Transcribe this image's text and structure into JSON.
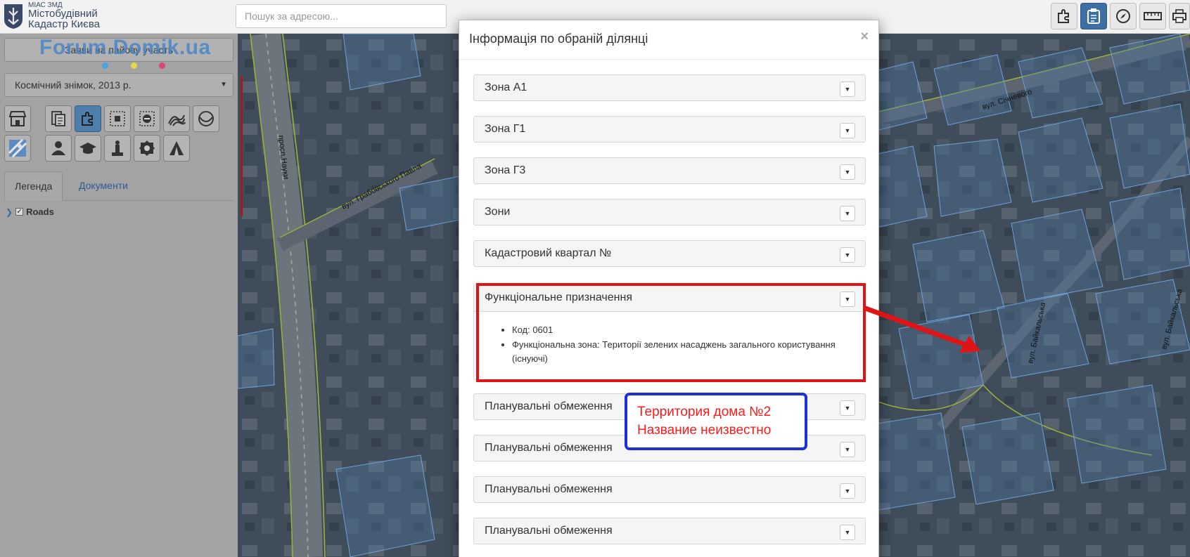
{
  "header": {
    "logo_small": "МІАС ЗМД",
    "logo_line1": "Містобудівний",
    "logo_line2": "Кадастр Києва",
    "search_placeholder": "Пошук за адресою..."
  },
  "sidebar": {
    "apply_button": "Заяви на пайову участь",
    "watermark": "Forum.Domik.ua",
    "layer_select": "Космічний знімок, 2013 р.",
    "tabs": [
      {
        "label": "Легенда",
        "active": true
      },
      {
        "label": "Документи",
        "active": false
      }
    ],
    "legend_item": "Roads"
  },
  "map": {
    "labels": [
      "просп.Науки",
      "вул. Грабовського Павла",
      "вул. Січневого",
      "вул. Байкальська",
      "вул. Байкальська"
    ]
  },
  "modal": {
    "title": "Інформація по обраній ділянці",
    "close": "×",
    "panels": [
      {
        "title": "Зона А1"
      },
      {
        "title": "Зона Г1"
      },
      {
        "title": "Зона Г3"
      },
      {
        "title": "Зони"
      },
      {
        "title": "Кадастровий квартал №"
      },
      {
        "title": "Функціональне призначення"
      },
      {
        "title": "Планувальні обмеження"
      },
      {
        "title": "Планувальні обмеження"
      },
      {
        "title": "Планувальні обмеження"
      },
      {
        "title": "Планувальні обмеження"
      }
    ],
    "open_panel": {
      "items": [
        "Код: 0601",
        "Функціональна зона: Території зелених насаджень загального користування (існуючі)"
      ]
    }
  },
  "annotation": {
    "line1": "Территория дома №2",
    "line2": "Название неизвестно"
  },
  "colors": {
    "annotation_text": "#ff1a1a",
    "annotation_border": "#1d2fd6",
    "highlight_frame": "#e01414",
    "active_button": "#3d6fa3"
  }
}
